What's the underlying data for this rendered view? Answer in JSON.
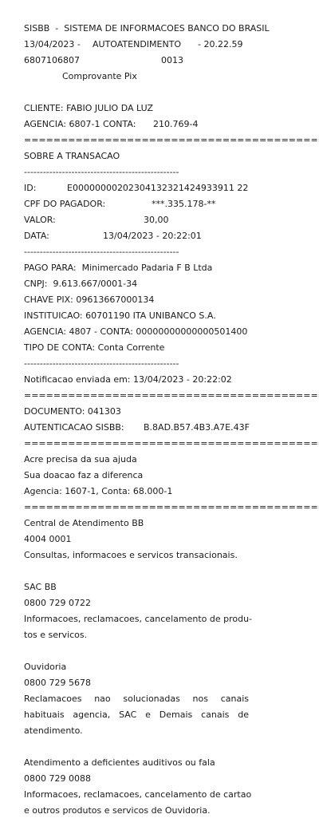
{
  "header": {
    "system": "SISBB  -  SISTEMA DE INFORMACOES BANCO DO BRASIL",
    "date": "13/04/2023 -",
    "channel": "AUTOATENDIMENTO",
    "time": "- 20.22.59",
    "terminal": "6807106807",
    "sequence": "0013",
    "title": "Comprovante Pix"
  },
  "client": {
    "name_line": "CLIENTE: FABIO JULIO DA LUZ",
    "agency_label": "AGENCIA: 6807-1 CONTA:",
    "account": "210.769-4"
  },
  "separators": {
    "double": "==================================================",
    "single": "-------------------------------------------------"
  },
  "transaction": {
    "section_title": "SOBRE A TRANSACAO",
    "id_label": "ID:",
    "id_value": "E00000000202304132321424933911 22",
    "payer_cpf_label": "CPF DO PAGADOR:",
    "payer_cpf_value": "***.335.178-**",
    "value_label": "VALOR:",
    "value_amount": "30,00",
    "date_label": "DATA:",
    "date_value": "13/04/2023 - 20:22:01"
  },
  "payee": {
    "pay_to": "PAGO PARA:  Minimercado Padaria F B Ltda",
    "cnpj": "CNPJ:  9.613.667/0001-34",
    "pix_key": "CHAVE PIX: 09613667000134",
    "institution": "INSTITUICAO: 60701190 ITA UNIBANCO S.A.",
    "agency_account": "AGENCIA: 4807 - CONTA: 00000000000000501400",
    "account_type": "TIPO DE CONTA: Conta Corrente"
  },
  "notification": "Notificacao enviada em: 13/04/2023 - 20:22:02",
  "document": {
    "number": "DOCUMENTO: 041303",
    "auth_label": "AUTENTICACAO SISBB:",
    "auth_value": "B.8AD.B57.4B3.A7E.43F"
  },
  "donation": {
    "line1": "Acre precisa da sua ajuda",
    "line2": "Sua doacao faz a diferenca",
    "line3": "Agencia: 1607-1, Conta: 68.000-1"
  },
  "support": {
    "central_title": "Central de Atendimento BB",
    "central_phone": "4004 0001",
    "central_desc": "Consultas, informacoes e servicos transacionais.",
    "sac_title": "SAC BB",
    "sac_phone": "0800 729 0722",
    "sac_desc_1": "Informacoes, reclamacoes, cancelamento de produ-",
    "sac_desc_2": "tos e servicos.",
    "ouv_title": "Ouvidoria",
    "ouv_phone": "0800 729 5678",
    "ouv_desc_1": "Reclamacoes nao solucionadas nos canais",
    "ouv_desc_2": "habituais agencia, SAC e Demais canais de",
    "ouv_desc_3": "atendimento.",
    "def_title": "Atendimento a deficientes auditivos ou fala",
    "def_phone": "0800 729 0088",
    "def_desc_1": "Informacoes, reclamacoes, cancelamento de cartao",
    "def_desc_2": "e outros produtos e servicos de Ouvidoria."
  }
}
